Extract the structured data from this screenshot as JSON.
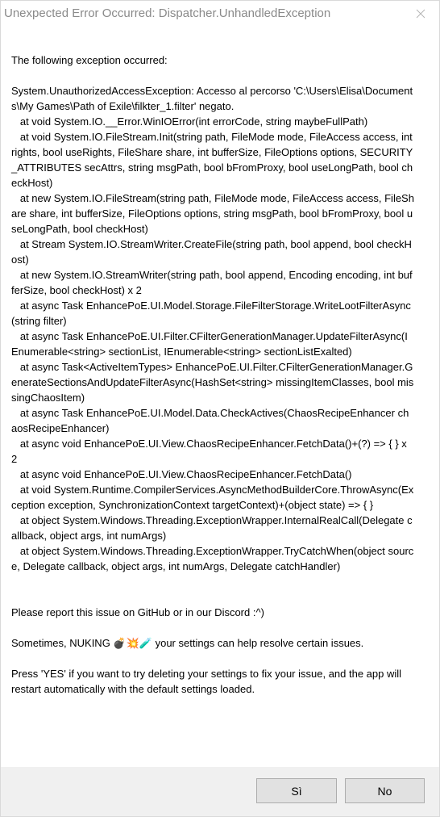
{
  "window": {
    "title": "Unexpected Error Occurred: Dispatcher.UnhandledException",
    "close_icon": "close-icon"
  },
  "message": {
    "intro": "The following exception occurred:",
    "stack_lines": [
      "System.UnauthorizedAccessException: Accesso al percorso 'C:\\Users\\Elisa\\Documents\\My Games\\Path of Exile\\filkter_1.filter' negato.",
      "   at void System.IO.__Error.WinIOError(int errorCode, string maybeFullPath)",
      "   at void System.IO.FileStream.Init(string path, FileMode mode, FileAccess access, int rights, bool useRights, FileShare share, int bufferSize, FileOptions options, SECURITY_ATTRIBUTES secAttrs, string msgPath, bool bFromProxy, bool useLongPath, bool checkHost)",
      "   at new System.IO.FileStream(string path, FileMode mode, FileAccess access, FileShare share, int bufferSize, FileOptions options, string msgPath, bool bFromProxy, bool useLongPath, bool checkHost)",
      "   at Stream System.IO.StreamWriter.CreateFile(string path, bool append, bool checkHost)",
      "   at new System.IO.StreamWriter(string path, bool append, Encoding encoding, int bufferSize, bool checkHost) x 2",
      "   at async Task EnhancePoE.UI.Model.Storage.FileFilterStorage.WriteLootFilterAsync(string filter)",
      "   at async Task EnhancePoE.UI.Filter.CFilterGenerationManager.UpdateFilterAsync(IEnumerable<string> sectionList, IEnumerable<string> sectionListExalted)",
      "   at async Task<ActiveItemTypes> EnhancePoE.UI.Filter.CFilterGenerationManager.GenerateSectionsAndUpdateFilterAsync(HashSet<string> missingItemClasses, bool missingChaosItem)",
      "   at async Task EnhancePoE.UI.Model.Data.CheckActives(ChaosRecipeEnhancer chaosRecipeEnhancer)",
      "   at async void EnhancePoE.UI.View.ChaosRecipeEnhancer.FetchData()+(?) => { } x 2",
      "   at async void EnhancePoE.UI.View.ChaosRecipeEnhancer.FetchData()",
      "   at void System.Runtime.CompilerServices.AsyncMethodBuilderCore.ThrowAsync(Exception exception, SynchronizationContext targetContext)+(object state) => { }",
      "   at object System.Windows.Threading.ExceptionWrapper.InternalRealCall(Delegate callback, object args, int numArgs)",
      "   at object System.Windows.Threading.ExceptionWrapper.TryCatchWhen(object source, Delegate callback, object args, int numArgs, Delegate catchHandler)"
    ],
    "report": "Please report this issue on GitHub or in our Discord :^)",
    "nuke": "Sometimes, NUKING 💣💥🧪 your settings can help resolve certain issues.",
    "instructions": "Press 'YES' if you want to try deleting your settings to fix your issue, and the app will restart automatically with the default settings loaded."
  },
  "buttons": {
    "yes_label": "Sì",
    "no_label": "No"
  }
}
